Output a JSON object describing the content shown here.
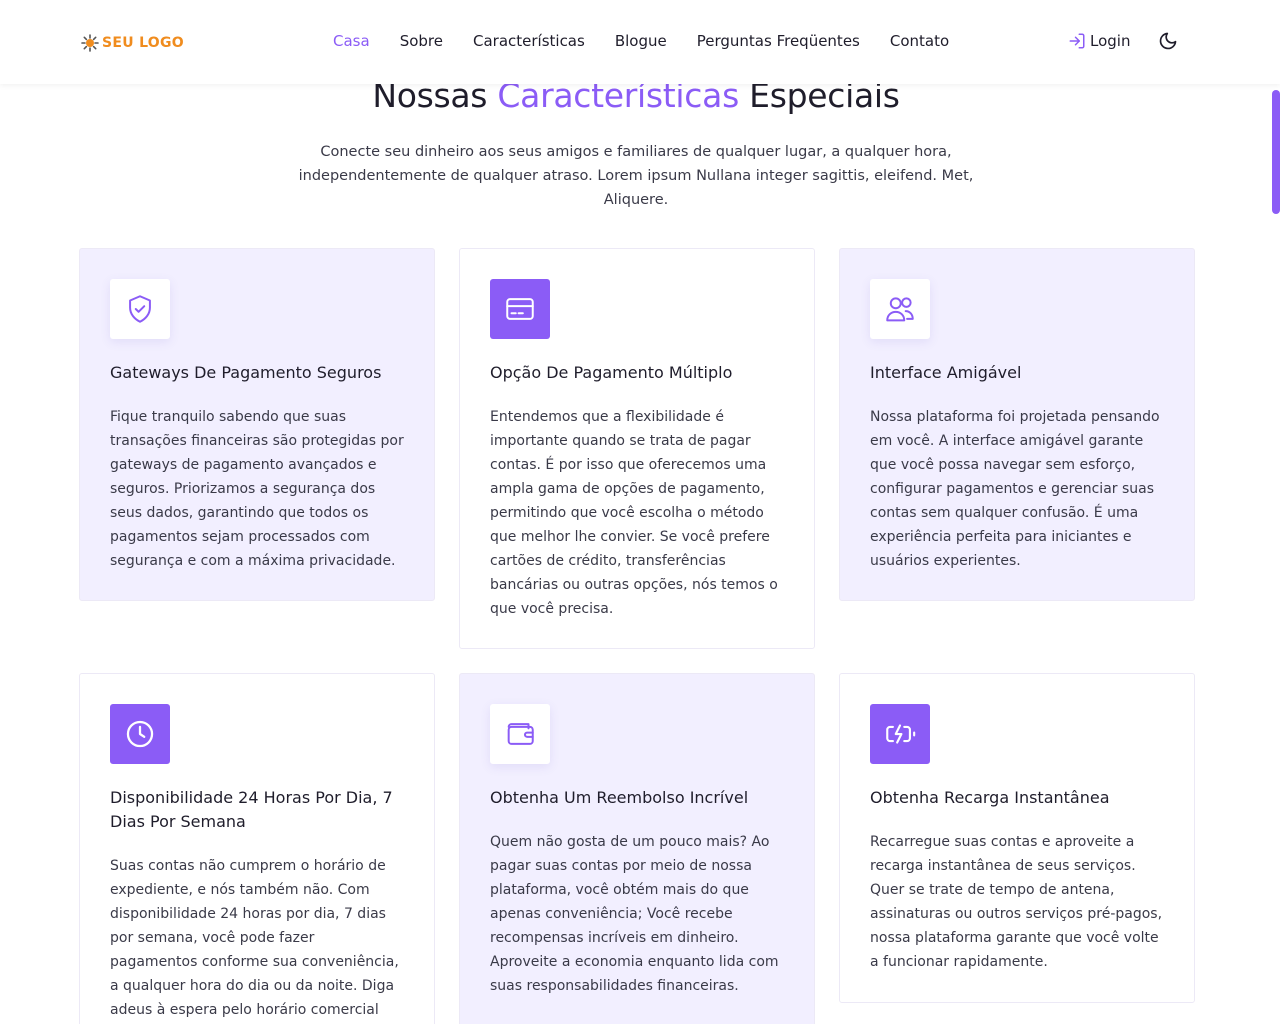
{
  "brand": {
    "logo_text": "SEU LOGO",
    "logo_color": "#f08c1e",
    "accent_color": "#8b5cf6"
  },
  "nav": {
    "items": [
      {
        "label": "Casa",
        "active": true
      },
      {
        "label": "Sobre"
      },
      {
        "label": "Características"
      },
      {
        "label": "Blogue"
      },
      {
        "label": "Perguntas Freqüentes"
      },
      {
        "label": "Contato"
      }
    ],
    "login_label": "Login"
  },
  "section": {
    "title_pre": "Nossas",
    "title_accent": "Características",
    "title_post": "Especiais",
    "subtitle": "Conecte seu dinheiro aos seus amigos e familiares de qualquer lugar, a qualquer hora, independentemente de qualquer atraso. Lorem ipsum Nullana integer sagittis, eleifend. Met, Aliquere."
  },
  "features": [
    {
      "icon": "shield-check-icon",
      "title": "Gateways De Pagamento Seguros",
      "text": "Fique tranquilo sabendo que suas transações financeiras são protegidas por gateways de pagamento avançados e seguros. Priorizamos a segurança dos seus dados, garantindo que todos os pagamentos sejam processados com segurança e com a máxima privacidade."
    },
    {
      "icon": "credit-card-icon",
      "title": "Opção De Pagamento Múltiplo",
      "text": "Entendemos que a flexibilidade é importante quando se trata de pagar contas. É por isso que oferecemos uma ampla gama de opções de pagamento, permitindo que você escolha o método que melhor lhe convier. Se você prefere cartões de crédito, transferências bancárias ou outras opções, nós temos o que você precisa."
    },
    {
      "icon": "users-icon",
      "title": "Interface Amigável",
      "text": "Nossa plataforma foi projetada pensando em você. A interface amigável garante que você possa navegar sem esforço, configurar pagamentos e gerenciar suas contas sem qualquer confusão. É uma experiência perfeita para iniciantes e usuários experientes."
    },
    {
      "icon": "clock-icon",
      "title": "Disponibilidade 24 Horas Por Dia, 7 Dias Por Semana",
      "text": "Suas contas não cumprem o horário de expediente, e nós também não. Com disponibilidade 24 horas por dia, 7 dias por semana, você pode fazer pagamentos conforme sua conveniência, a qualquer hora do dia ou da noite. Diga adeus à espera pelo horário comercial para"
    },
    {
      "icon": "wallet-icon",
      "title": "Obtenha Um Reembolso Incrível",
      "text": "Quem não gosta de um pouco mais? Ao pagar suas contas por meio de nossa plataforma, você obtém mais do que apenas conveniência; Você recebe recompensas incríveis em dinheiro. Aproveite a economia enquanto lida com suas responsabilidades financeiras."
    },
    {
      "icon": "battery-charging-icon",
      "title": "Obtenha Recarga Instantânea",
      "text": "Recarregue suas contas e aproveite a recarga instantânea de seus serviços. Quer se trate de tempo de antena, assinaturas ou outros serviços pré-pagos, nossa plataforma garante que você volte a funcionar rapidamente."
    }
  ]
}
